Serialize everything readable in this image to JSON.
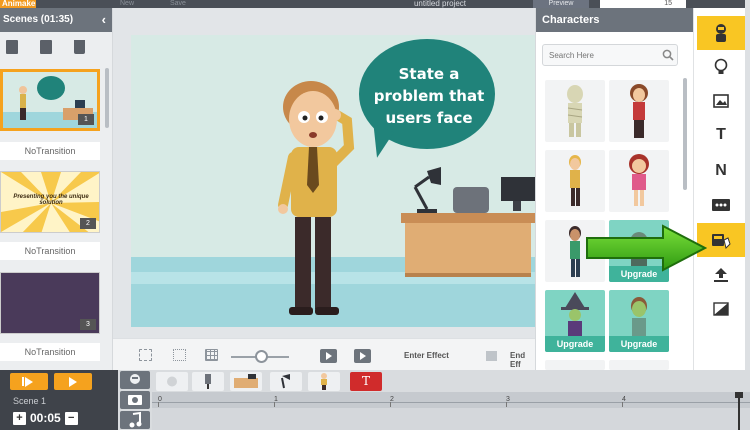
{
  "app": {
    "logo": "Animaker",
    "project_title": "untitled project",
    "menu": {
      "new": "New",
      "save": "Save"
    },
    "preview_label": "Preview",
    "zoom_value": "15"
  },
  "scenes_panel": {
    "title": "Scenes (01:35)",
    "scenes": [
      {
        "number": "1",
        "transition": "NoTransition",
        "caption": "State a problem that users face"
      },
      {
        "number": "2",
        "transition": "NoTransition",
        "caption": "Presenting you the unique solution"
      },
      {
        "number": "3",
        "transition": "NoTransition",
        "caption": ""
      }
    ]
  },
  "canvas": {
    "bubble_lines": [
      "State a",
      "problem that",
      "users face"
    ]
  },
  "canvas_toolbar": {
    "enter_effect_label": "Enter Effect",
    "exit_effect_label": "End Eff"
  },
  "characters_panel": {
    "title": "Characters",
    "search_placeholder": "Search Here",
    "upgrade_label": "Upgrade",
    "tiles": [
      {
        "figure": "mummy",
        "upgrade": false
      },
      {
        "figure": "woman-brown-hair",
        "upgrade": false
      },
      {
        "figure": "man-blonde",
        "upgrade": false
      },
      {
        "figure": "girl-red-hair",
        "upgrade": false
      },
      {
        "figure": "man-green-shirt",
        "upgrade": false
      },
      {
        "figure": "locked-character",
        "upgrade": true
      },
      {
        "figure": "witch",
        "upgrade": true
      },
      {
        "figure": "zombie",
        "upgrade": true
      }
    ]
  },
  "tool_rail": {
    "icons": [
      "character-icon",
      "bulb-icon",
      "image-icon",
      "text-icon",
      "number-icon",
      "video-icon",
      "props-icon",
      "upload-icon",
      "background-icon"
    ],
    "text_glyph": "T",
    "number_glyph": "N"
  },
  "timeline": {
    "scene_label": "Scene 1",
    "duration": "00:05",
    "plus": "+",
    "minus": "−",
    "text_object_glyph": "T",
    "ruler_ticks": [
      "0",
      "1",
      "2",
      "3",
      "4"
    ]
  },
  "colors": {
    "accent": "#f9c623",
    "orange": "#f5a21e",
    "teal": "#20837a",
    "upgrade": "#3fb39b",
    "arrow_green": "#4cbb17"
  }
}
